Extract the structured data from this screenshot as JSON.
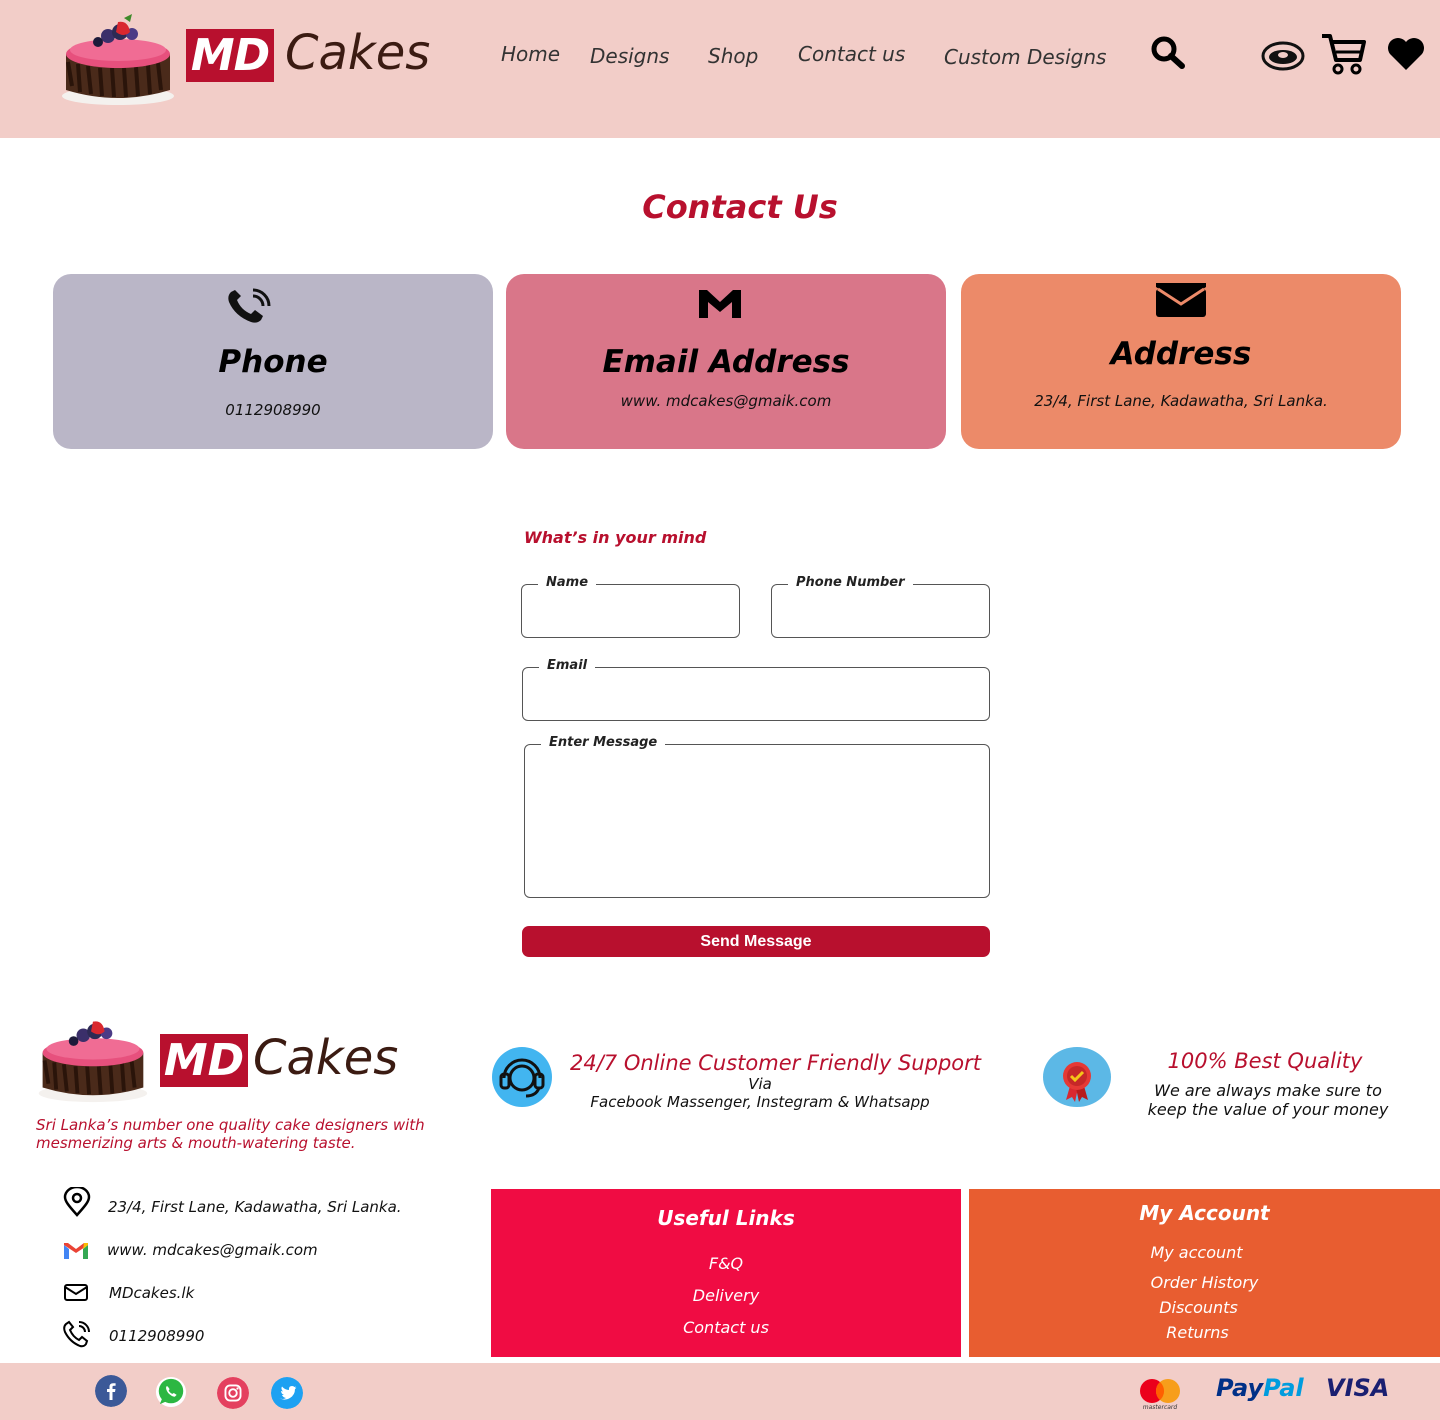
{
  "header": {
    "brand_md": "MD",
    "brand_cakes": "Cakes",
    "nav": [
      "Home",
      "Designs",
      "Shop",
      "Contact us",
      "Custom Designs"
    ]
  },
  "page_title": "Contact Us",
  "cards": {
    "phone": {
      "title": "Phone",
      "value": "0112908990",
      "color": "#bab6c7"
    },
    "email": {
      "title": "Email Address",
      "value": "www. mdcakes@gmaik.com",
      "color": "#d97689"
    },
    "address": {
      "title": "Address",
      "value": "23/4, First Lane, Kadawatha, Sri Lanka.",
      "color": "#ec8a69"
    }
  },
  "form": {
    "heading": "What’s in your mind",
    "name_label": "Name",
    "phone_label": "Phone Number",
    "email_label": "Email",
    "message_label": "Enter Message",
    "send_label": "Send Message"
  },
  "footer": {
    "brand_md": "MD",
    "brand_cakes": "Cakes",
    "tagline": "Sri Lanka’s number one quality cake designers with mesmerizing arts & mouth-watering taste.",
    "support_title": "24/7  Online Customer Friendly Support",
    "support_via": "Via",
    "support_channels": "Facebook Massenger, Instegram & Whatsapp",
    "quality_title": "100% Best Quality",
    "quality_text": "We are always make sure to keep the value of your money",
    "contacts": {
      "address": "23/4, First Lane, Kadawatha, Sri Lanka.",
      "email": "www. mdcakes@gmaik.com",
      "web": "MDcakes.lk",
      "phone": "0112908990"
    },
    "useful_links": {
      "title": "Useful Links",
      "items": [
        "F&Q",
        "Delivery",
        "Contact us"
      ],
      "color": "#f00c43"
    },
    "my_account": {
      "title": "My Account",
      "items": [
        "My account",
        "Order History",
        "Discounts",
        "Returns"
      ],
      "color": "#e85d30"
    },
    "payments": {
      "mastercard_caption": "mastercard",
      "paypal": "PayPal",
      "visa": "VISA"
    }
  },
  "colors": {
    "accent": "#b8102e",
    "header_bg": "#f2cdc8"
  },
  "icons": [
    "search-icon",
    "eye-icon",
    "cart-icon",
    "heart-icon",
    "phone-icon",
    "gmail-icon",
    "envelope-icon",
    "headset-icon",
    "award-icon",
    "location-icon",
    "facebook-icon",
    "whatsapp-icon",
    "instagram-icon",
    "twitter-icon"
  ]
}
